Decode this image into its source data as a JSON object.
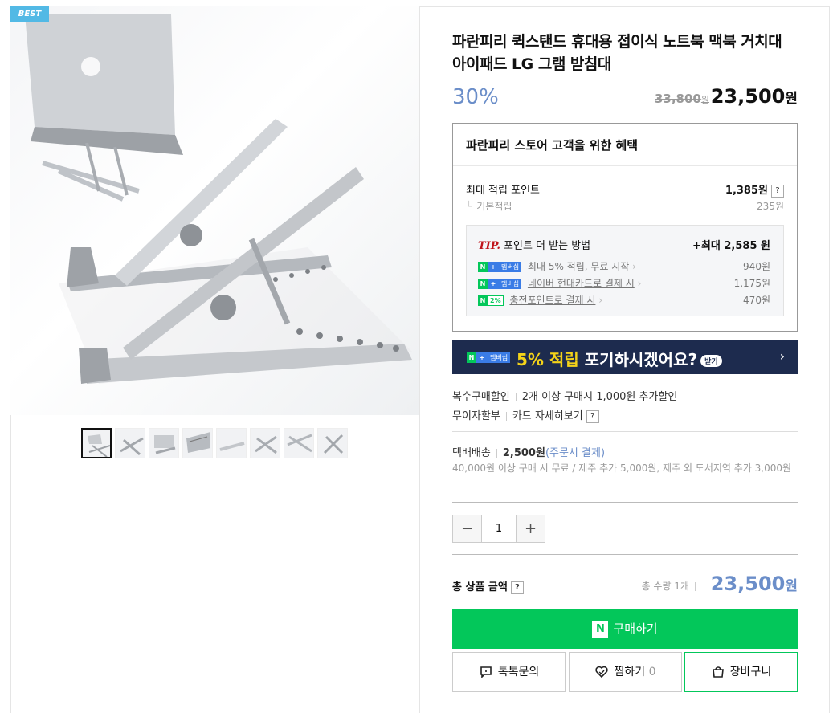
{
  "gallery": {
    "best_badge": "BEST",
    "thumbnail_count": 8
  },
  "product": {
    "title": "파란피리 퀵스탠드 휴대용 접이식 노트북 맥북 거치대 아이패드 LG 그램 받침대",
    "discount": "30%",
    "original_price": "33,800",
    "original_unit": "원",
    "sale_price": "23,500",
    "sale_unit": "원"
  },
  "benefit": {
    "header": "파란피리 스토어 고객을 위한 혜택",
    "max_point_label": "최대 적립 포인트",
    "max_point_value": "1,385원",
    "help": "?",
    "base_label": "기본적립",
    "base_value": "235원",
    "tip_label": "TIP.",
    "tip_text": "포인트 더 받는 방법",
    "tip_max": "+최대 2,585 원",
    "tips": [
      {
        "badge_main": "N",
        "badge_plus": "+",
        "badge_text": "멤버십",
        "text": "최대 5% 적립, 무료 시작",
        "amount": "940원"
      },
      {
        "badge_main": "N",
        "badge_plus": "+",
        "badge_text": "멤버십",
        "text": "네이버 현대카드로 결제 시",
        "amount": "1,175원"
      },
      {
        "badge_main": "N",
        "badge_plus": "",
        "badge_text": "2%",
        "text": "충전포인트로 결제 시",
        "amount": "470원"
      }
    ]
  },
  "banner": {
    "badge_n": "N",
    "badge_plus": "+",
    "badge_mem": "멤버십",
    "highlight": "5% 적립",
    "text": " 포기하시겠어요?",
    "pill": "받기",
    "arrow": "›"
  },
  "info": {
    "multi_label": "복수구매할인",
    "multi_value": "2개 이상 구매시 1,000원 추가할인",
    "installment_label": "무이자할부",
    "installment_value": "카드 자세히보기",
    "help": "?",
    "delivery_label": "택배배송",
    "delivery_price": "2,500원",
    "delivery_note": "(주문시 결제)",
    "delivery_detail": "40,000원 이상 구매 시 무료 / 제주 추가 5,000원, 제주 외 도서지역 추가 3,000원"
  },
  "quantity": {
    "minus": "−",
    "value": "1",
    "plus": "+"
  },
  "total": {
    "label": "총 상품 금액",
    "help": "?",
    "count": "총 수량 1개",
    "price": "23,500",
    "unit": "원"
  },
  "buttons": {
    "buy_logo": "N",
    "buy": "구매하기",
    "talk": "톡톡문의",
    "wish": "찜하기",
    "wish_count": "0",
    "cart": "장바구니"
  },
  "colors": {
    "accent_blue": "#6b8ec9",
    "naver_green": "#03c75a",
    "banner_navy": "#1d2b4e",
    "best_badge": "#52b9e5"
  }
}
